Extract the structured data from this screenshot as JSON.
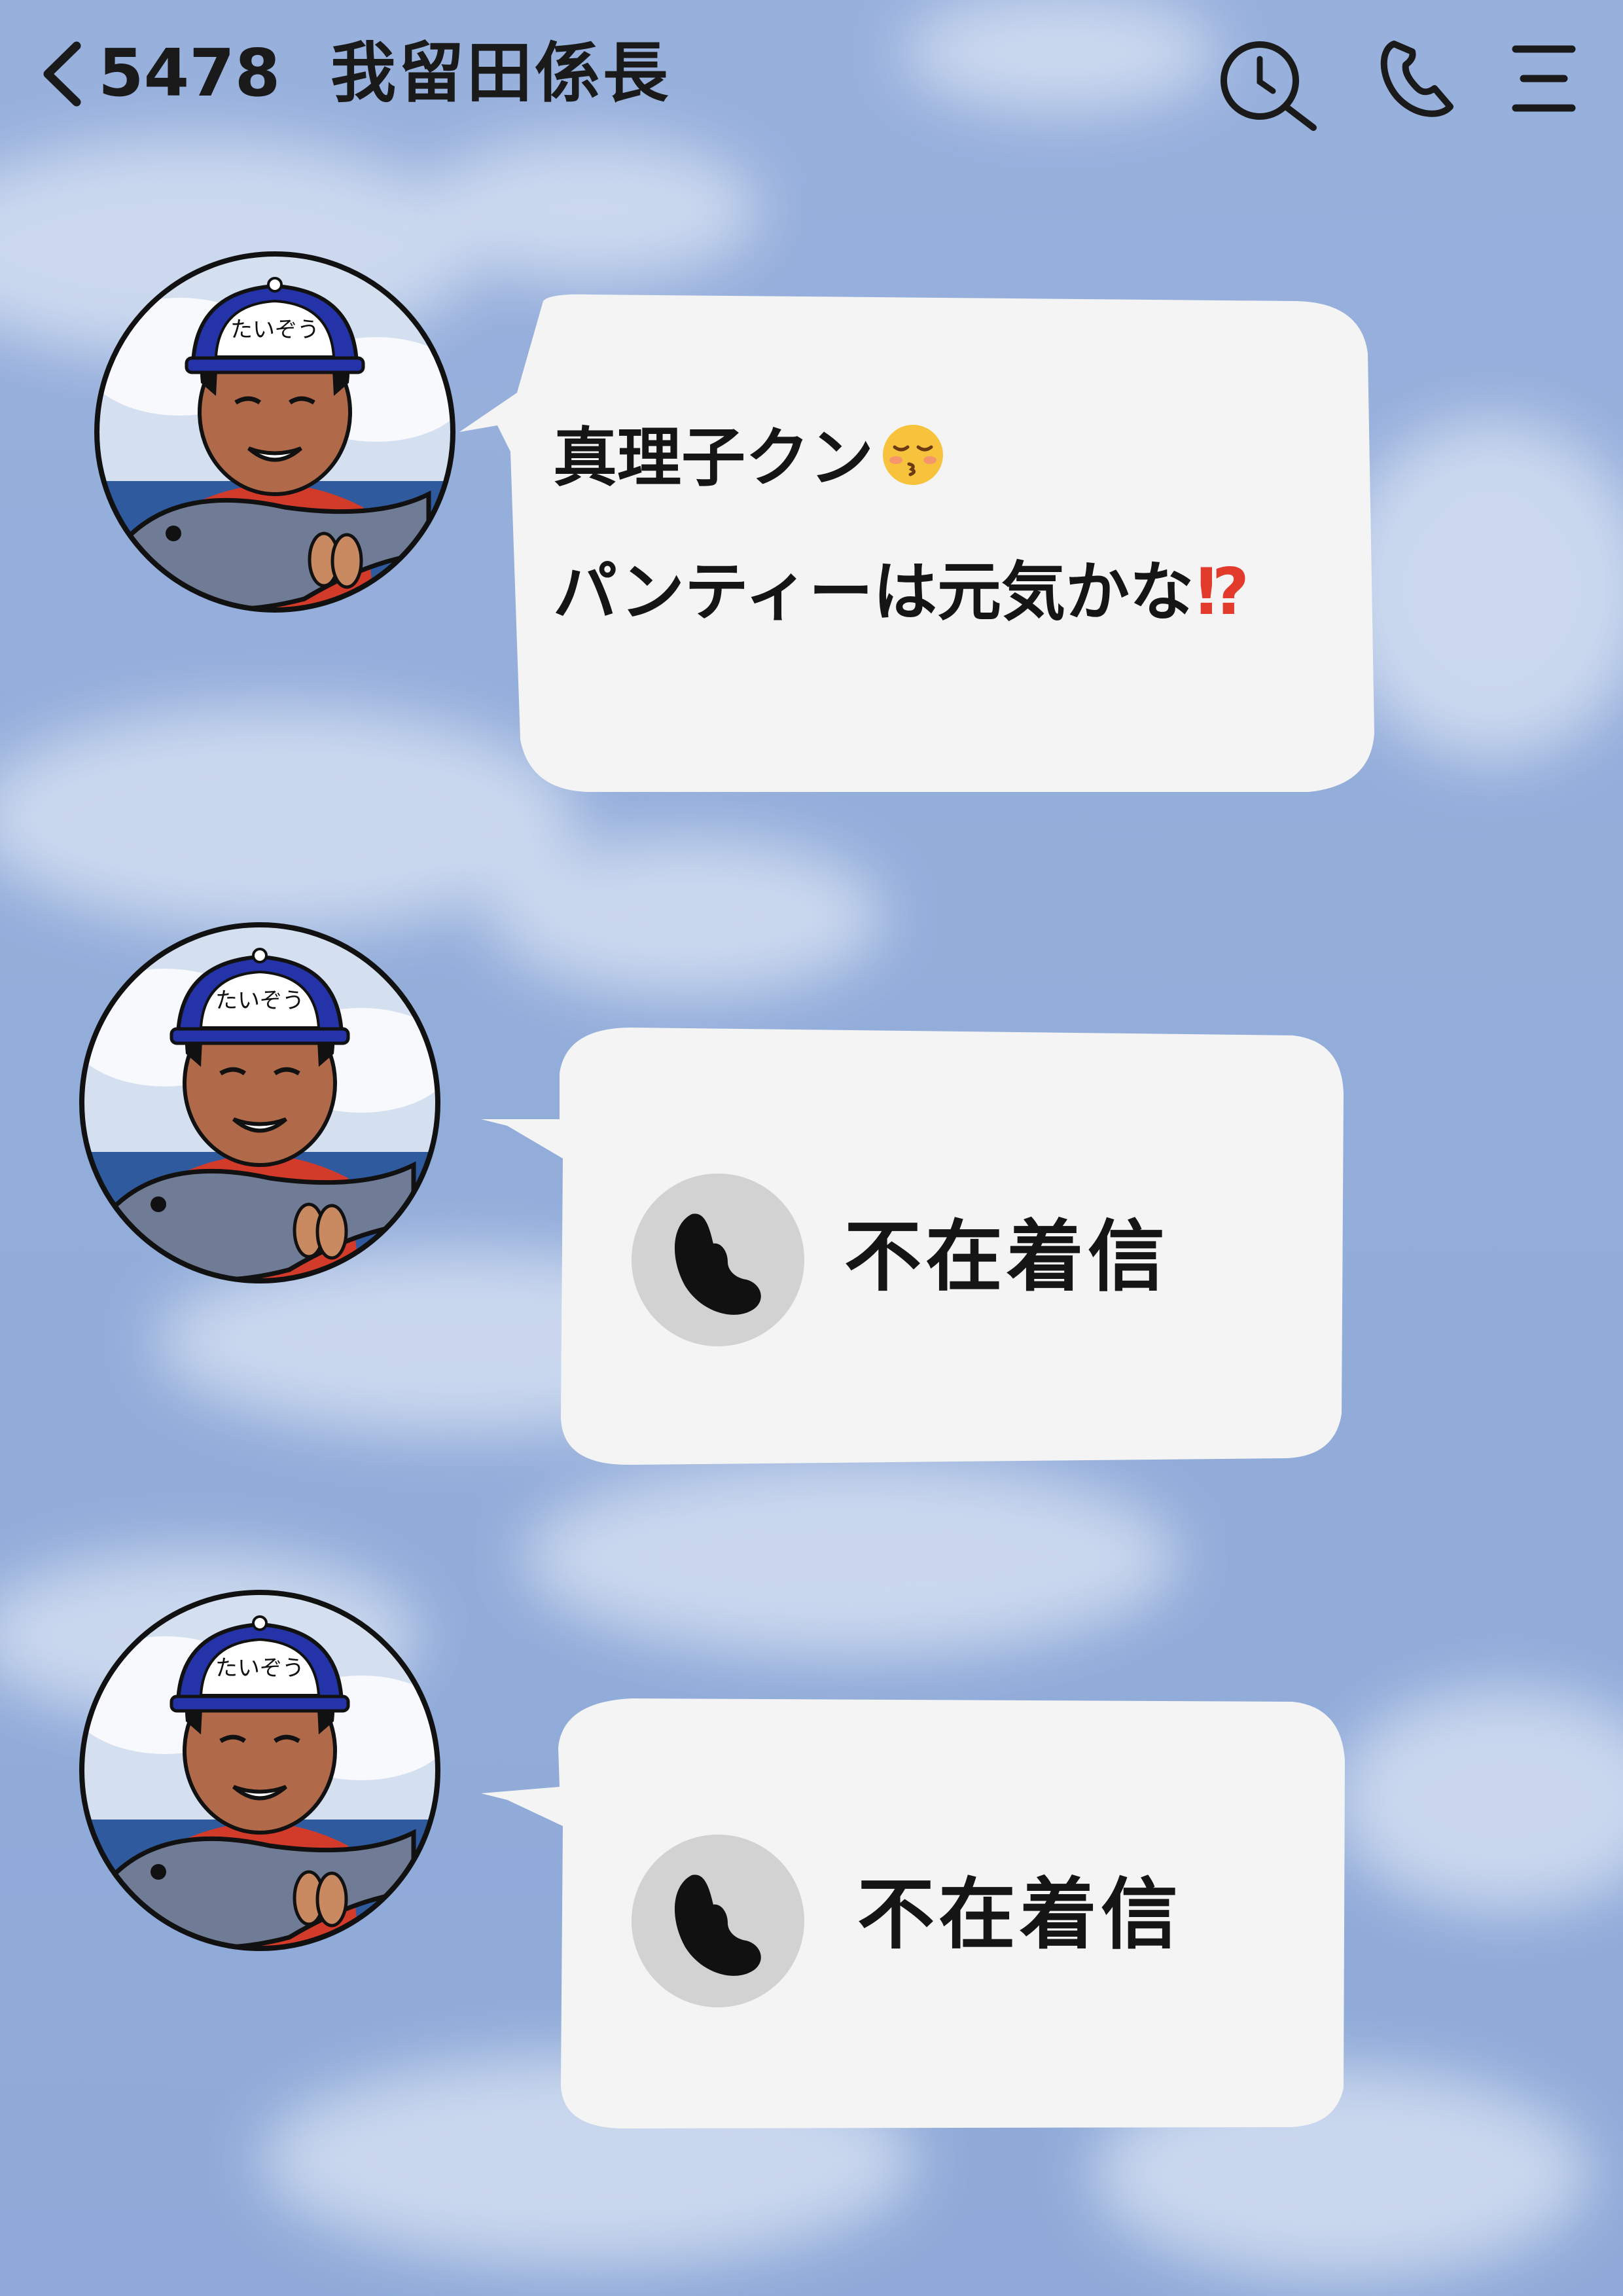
{
  "header": {
    "unread_count": "5478",
    "chat_title": "我留田係長",
    "icons": [
      "chevron-left-icon",
      "search-history-icon",
      "phone-icon",
      "menu-icon"
    ]
  },
  "colors": {
    "background": "#94aedb",
    "bubble": "#f4f4f4",
    "text": "#151515",
    "accent_red": "#e23b2c"
  },
  "messages": [
    {
      "type": "text",
      "lines": [
        "真理子クン",
        "パンティーは元気かな"
      ],
      "emoji": "kissing-face-icon",
      "emoji_after_line": 1,
      "trailing_mark": "⁉"
    },
    {
      "type": "missed_call",
      "label": "不在着信",
      "icon": "phone-icon"
    },
    {
      "type": "missed_call",
      "label": "不在着信",
      "icon": "phone-icon"
    }
  ],
  "avatar": {
    "cap_text": "たいぞう",
    "description_icon": "avatar-man-with-fish"
  }
}
